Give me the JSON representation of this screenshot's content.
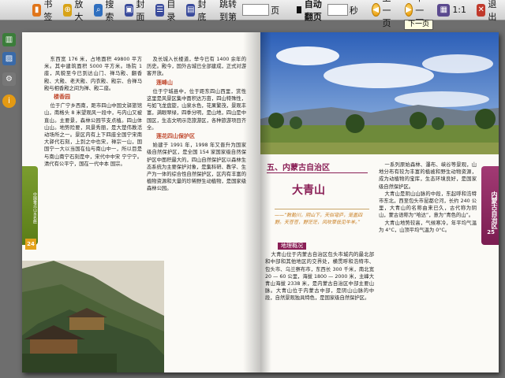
{
  "toolbar": {
    "bookmark": "书签",
    "zoom": "放大",
    "search": "搜索",
    "cover": "封面",
    "toc": "目录",
    "back_cover": "封底",
    "goto_label": "跳转到第",
    "goto_unit": "页",
    "auto_flip": "自动翻页",
    "seconds": "秒",
    "prev": "上一页",
    "next": "下一页",
    "ratio": "1:1",
    "exit": "退出",
    "goto_value": "",
    "seconds_value": ""
  },
  "tooltip": "下一页",
  "left_page": {
    "col1_p1": "东西宽 176 米，占地面积 49800 平方米。其中建筑面积 5000 平方米。场院 1 座，风貌至今已到达山门、禅马殿、翻香殿、大殿、老天殿、内衣殿、殿宗、合禅马殿与相香殿之间为禅、殿二座。",
    "col1_sub": "楼香园",
    "col1_p2": "位于广宁乡西南，距市四山中国文驿旅馆山，南格头 8 米望观风一段中，与内山又被直山。主要景，森林公园节支点植。四山体山山。地势险要，风景秀丽，是大楚伟教活动场所之一。景区内有上下四座全国宁宋南大驿代石刻，上到之中也宋，禅宗一山，国国宁一大以当国在仙与南山中一，所以目是与南山南宁石刻是中，宋代中中宋 宁宁宁。清代有公平宁，国在一代中本 国宗。",
    "col2_p1": "及长城入长楼道，举今已有 1400 余年的历史。殿今，国外古城已全部建成，正式对游客开放。",
    "col2_sub1": "莲峰山",
    "col2_p2": "位于宁城县中，位于距东四山西里，赏性这里是风景区集中面积达万亩，四山特殊性，与如飞龙盘旋，山泉水色，花果繁茂，景观丰富，满眼翠绿，四季分明，是山地，四山是中国区，生态文明示范旅游区，各种旅游项目齐全。",
    "col2_sub2": "莲花四山保护区",
    "col2_p3": "始建于 1991 年，1998 年又晋升为国家级自然保护区，是全国 154 家国家级自然保护区中面积最大的，四山自然保护区以森林生态系统为主要保护对象，是集科研、教学、生产为一体的综合性自然保护区，区内有丰富的植物资源和大量的珍稀野生动植物，是国家级森林公园。",
    "tab_text": "中国重点山水名胜",
    "page_num": "24"
  },
  "right_page": {
    "section_title": "五、内蒙古自治区",
    "big_title": "大青山",
    "poem": "——“敕勒川，阴山下，天似穹庐，笼盖四野。天苍苍，野茫茫，风吹草低见牛羊。”",
    "sub_box": "地理概况",
    "col1_p1": "大青山位于内蒙古自治区包头市城内的最北部和中部和其他地区的交界处，横贯呼和浩特市、包头市、乌兰察布市，东西长 300 千米，南北宽 20 — 60 公里，海拔 1800 — 2000 米，主峰大青山海拔 2338 米，是内蒙古自治区中部主要山脉。大青山位于内蒙古中部，是阴山山脉的中段，自然景观独具特色，是国家级自然保护区。",
    "col2_p1": "一系列原始森林、瀑布、峡谷等景观，山地分布有较为丰富的植被和野生动物资源，成为动植物的宝库，生态环境良好，是国家级自然保护区。",
    "col2_p2": "大青山是阴山山脉的中段，东起呼和浩特市东北，西至包头市昆都仑河，长约 240 公里，大青山的名称由来已久，古代称为阴山，蒙古语称为“哈达”，意为“青色的山”。",
    "col2_p3": "大青山地势较高，气候寒冷，年平均气温为 4°C，山顶平均气温为 0°C。",
    "tab_text": "内蒙古自治区",
    "page_num": "25"
  }
}
